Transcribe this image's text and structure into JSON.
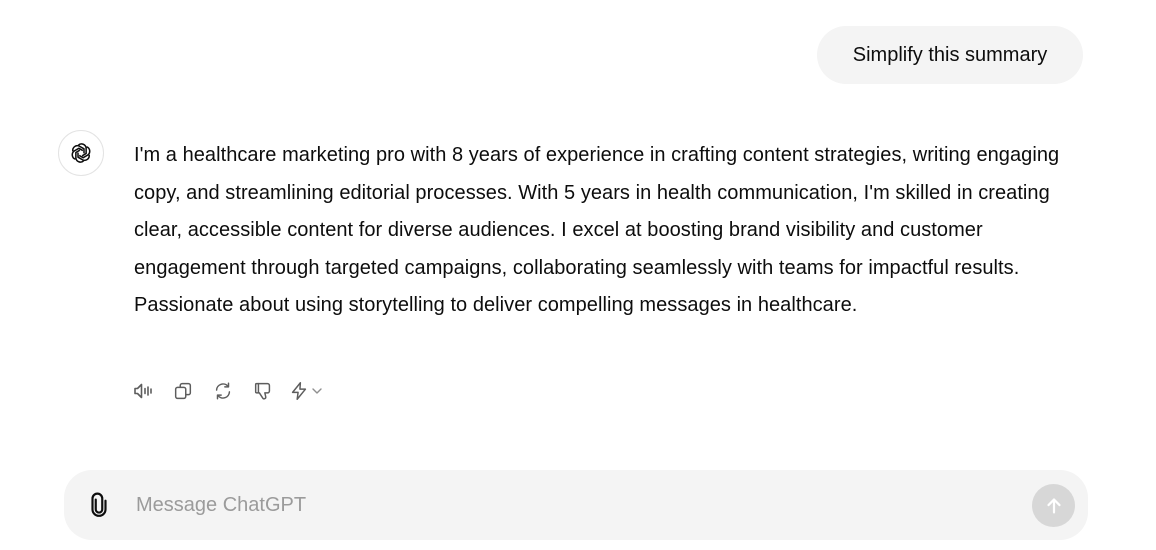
{
  "conversation": {
    "user_message": "Simplify this summary",
    "assistant_message": "I'm a healthcare marketing pro with 8 years of experience in crafting content strategies, writing engaging copy, and streamlining editorial processes. With 5 years in health communication, I'm skilled in creating clear, accessible content for diverse audiences. I excel at boosting brand visibility and customer engagement through targeted campaigns, collaborating seamlessly with teams for impactful results. Passionate about using storytelling to deliver compelling messages in healthcare."
  },
  "message_actions": [
    {
      "icon": "speaker-icon"
    },
    {
      "icon": "copy-icon"
    },
    {
      "icon": "regenerate-icon"
    },
    {
      "icon": "thumbs-down-icon"
    },
    {
      "icon": "lightning-icon"
    }
  ],
  "composer": {
    "placeholder": "Message ChatGPT",
    "value": ""
  },
  "colors": {
    "bubble_bg": "#f4f4f4",
    "composer_bg": "#f4f4f4",
    "send_button_disabled": "#d7d7d7",
    "icon_gray": "#5d5d5d"
  }
}
